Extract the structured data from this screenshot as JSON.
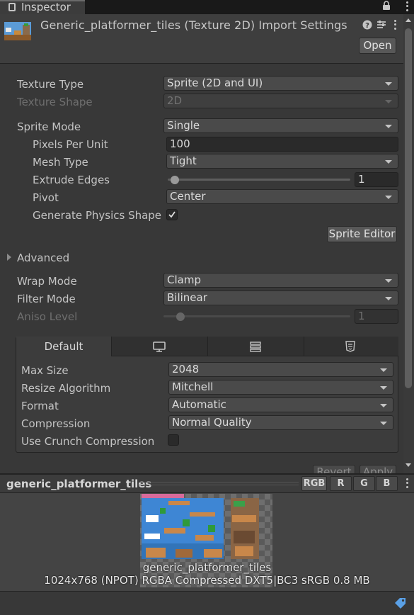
{
  "tab": {
    "label": "Inspector"
  },
  "header": {
    "title": "Generic_platformer_tiles (Texture 2D) Import Settings",
    "open_label": "Open"
  },
  "props": {
    "texture_type": {
      "label": "Texture Type",
      "value": "Sprite (2D and UI)"
    },
    "texture_shape": {
      "label": "Texture Shape",
      "value": "2D"
    },
    "sprite_mode": {
      "label": "Sprite Mode",
      "value": "Single"
    },
    "pixels_per_unit": {
      "label": "Pixels Per Unit",
      "value": "100"
    },
    "mesh_type": {
      "label": "Mesh Type",
      "value": "Tight"
    },
    "extrude_edges": {
      "label": "Extrude Edges",
      "value": "1",
      "level": 0.04
    },
    "pivot": {
      "label": "Pivot",
      "value": "Center"
    },
    "generate_physics": {
      "label": "Generate Physics Shape",
      "checked": true
    },
    "sprite_editor_label": "Sprite Editor",
    "advanced_label": "Advanced",
    "wrap_mode": {
      "label": "Wrap Mode",
      "value": "Clamp"
    },
    "filter_mode": {
      "label": "Filter Mode",
      "value": "Bilinear"
    },
    "aniso_level": {
      "label": "Aniso Level",
      "value": "1",
      "level": 0.09
    }
  },
  "platform": {
    "tabs": [
      {
        "label": "Default",
        "icon": null
      },
      {
        "label": "",
        "icon": "monitor-icon"
      },
      {
        "label": "",
        "icon": "server-icon"
      },
      {
        "label": "",
        "icon": "html5-icon"
      }
    ],
    "max_size": {
      "label": "Max Size",
      "value": "2048"
    },
    "resize_algorithm": {
      "label": "Resize Algorithm",
      "value": "Mitchell"
    },
    "format": {
      "label": "Format",
      "value": "Automatic"
    },
    "compression": {
      "label": "Compression",
      "value": "Normal Quality"
    },
    "use_crunch": {
      "label": "Use Crunch Compression",
      "checked": false
    }
  },
  "actions": {
    "revert_label": "Revert",
    "apply_label": "Apply"
  },
  "preview": {
    "title": "generic_platformer_tiles",
    "channels": [
      "RGB",
      "R",
      "G",
      "B"
    ],
    "caption_name": "generic_platformer_tiles",
    "caption_info": "1024x768 (NPOT)  RGBA Compressed DXT5|BC3 sRGB   0.8 MB"
  },
  "colors": {
    "background": "#383838",
    "accent": "#c4c4c4",
    "field": "#4a4a4a"
  }
}
